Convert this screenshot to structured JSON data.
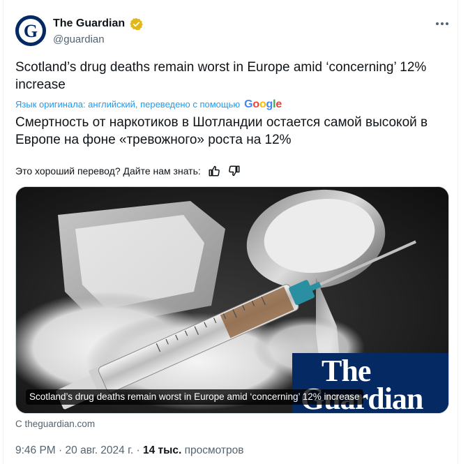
{
  "author": {
    "display_name": "The Guardian",
    "handle": "@guardian",
    "verified_color": "#f4b400",
    "avatar_letter": "G"
  },
  "icons": {
    "more": "more-dots-icon",
    "thumb_up": "thumbs-up-icon",
    "thumb_down": "thumbs-down-icon",
    "verified": "verified-badge-icon"
  },
  "tweet": {
    "text": "Scotland’s drug deaths remain worst in Europe amid ‘concerning’ 12% increase",
    "translation_note": "Язык оригинала: английский, переведено с помощью",
    "translation_provider": "Google",
    "translated_text": "Смертность от наркотиков в Шотландии остается самой высокой в Европе на фоне «тревожного» роста на 12%",
    "feedback_prompt": "Это хороший перевод? Дайте нам знать:"
  },
  "card": {
    "brand_line1": "The",
    "brand_line2": "Guardian",
    "caption": "Scotland’s drug deaths remain worst in Europe amid ‘concerning’ 12% increase",
    "source": "С theguardian.com"
  },
  "meta": {
    "time": "9:46 PM",
    "separator": "·",
    "date": "20 авг. 2024 г.",
    "views_count": "14 тыс.",
    "views_label": "просмотров"
  },
  "colors": {
    "accent": "#1d9bf0",
    "secondary_text": "#536471",
    "guardian_blue": "#052962"
  }
}
